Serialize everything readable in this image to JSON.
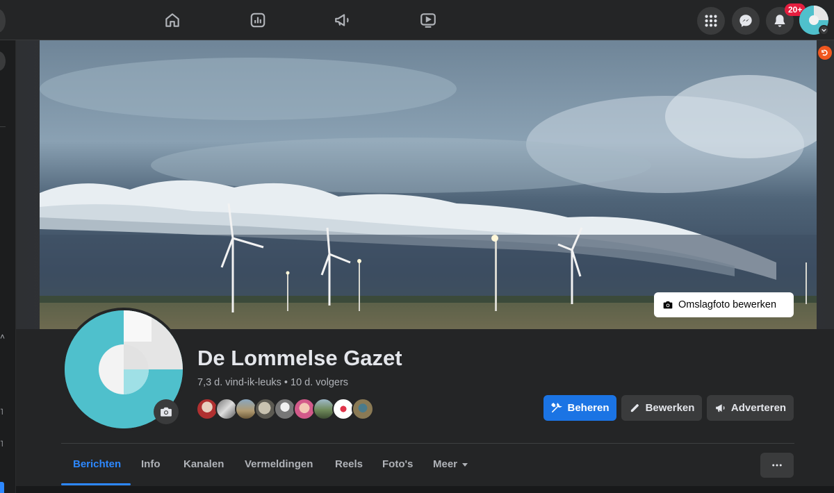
{
  "topbar": {
    "nav_icons": [
      "home-icon",
      "insights-icon",
      "megaphone-icon",
      "video-icon"
    ],
    "right_buttons": [
      "menu-grid-icon",
      "messenger-icon",
      "bell-icon"
    ],
    "notification_count": "20+",
    "accent_color": "#2d88ff"
  },
  "cover": {
    "edit_label": "Omslagfoto bewerken",
    "edit_icon": "camera-icon"
  },
  "page": {
    "name": "De Lommelse Gazet",
    "stats": "7,3 d. vind-ik-leuks • 10 d. volgers",
    "avatar_color": "#4fc0cc"
  },
  "actions": {
    "manage_label": "Beheren",
    "edit_label": "Bewerken",
    "ads_label": "Adverteren",
    "manage_color": "#1b74e4"
  },
  "tabs": [
    {
      "label": "Berichten",
      "active": true
    },
    {
      "label": "Info",
      "active": false
    },
    {
      "label": "Kanalen",
      "active": false
    },
    {
      "label": "Vermeldingen",
      "active": false
    },
    {
      "label": "Reels",
      "active": false
    },
    {
      "label": "Foto's",
      "active": false
    },
    {
      "label": "Meer",
      "active": false
    }
  ]
}
